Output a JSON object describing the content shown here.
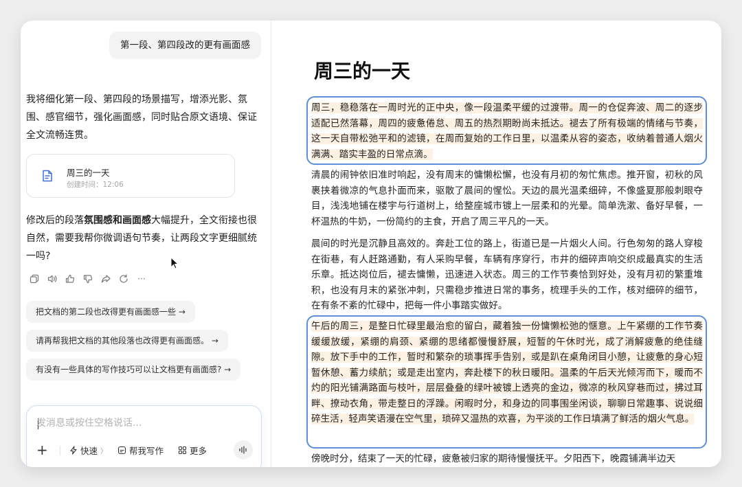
{
  "chat": {
    "user_message": "第一段、第四段改的更有画面感",
    "reply_intro": "我将细化第一段、第四段的场景描写，增添光影、氛围、感官细节，强化画面感，同时贴合原文语境、保证全文流畅连贯。",
    "doc_card": {
      "title": "周三的一天",
      "time": "创建时间：12:06"
    },
    "reply_followup_prefix": "修改后的段落",
    "reply_followup_bold": "氛围感和画面感",
    "reply_followup_suffix": "大幅提升，全文衔接也很自然，需要我帮你微调语句节奏，让两段文字更细腻统一吗?",
    "actions": [
      "copy-icon",
      "speaker-icon",
      "thumbs-up-icon",
      "thumbs-down-icon",
      "share-icon",
      "regenerate-icon",
      "more-icon"
    ],
    "more_label": "···",
    "suggestions": [
      "把文档的第二段也改得更有画面感一些 →",
      "请再帮我把文档的其他段落也改得更有画面感。 →",
      "有没有一些具体的写作技巧可以让文档更有画面感? →"
    ],
    "composer": {
      "placeholder": "发消息或按住空格说话...",
      "plus_label": "+",
      "quick_label": "快速",
      "quick_chevron": "〉",
      "write_label": "帮我写作",
      "more_label": "更多"
    }
  },
  "document": {
    "title": "周三的一天",
    "paragraphs": [
      {
        "text": "周三，稳稳落在一周时光的正中央，像一段温柔平缓的过渡带。周一的仓促奔波、周二的逐步适配已然落幕，周四的疲惫倦怠、周五的热烈期盼尚未抵达。褪去了所有极端的情绪与节奏，这一天自带松弛平和的滤镜，在周而复始的工作日里，以温柔从容的姿态，收纳着普通人烟火满满、踏实丰盈的日常点滴。",
        "highlighted": true
      },
      {
        "text": "清晨的闹钟依旧准时响起，没有周末的慵懒松懈，也没有月初的匆忙焦虑。推开窗，初秋的风裹挟着微凉的气息扑面而来，驱散了晨间的惺忪。天边的晨光温柔细碎，不像盛夏那般刺眼夺目，浅浅地铺在楼宇与行道树上，给整座城市镀上一层柔和的光晕。简单洗漱、备好早餐，一杯温热的牛奶，一份简约的主食，开启了周三平凡的一天。",
        "highlighted": false
      },
      {
        "text": "晨间的时光是沉静且高效的。奔赴工位的路上，街道已是一片烟火人间。行色匆匆的路人穿梭在街巷，有人赶路通勤，有人采购早餐，车辆有序穿行，市井的细碎声响交织成最真实的生活乐章。抵达岗位后，褪去慵懒，迅速进入状态。周三的工作节奏恰到好处，没有月初的繁重堆积，也没有月末的紧张冲刺，只需稳步推进日常的事务，梳理手头的工作，核对细碎的细节，在有条不紊的忙碌中，把每一件小事踏实做好。",
        "highlighted": false
      },
      {
        "text": "午后的周三，是整日忙碌里最治愈的留白，藏着独一份慵懒松弛的惬意。上午紧绷的工作节奏缓缓放缓，紧绷的肩颈、紧绷的思绪都慢慢舒展，短暂的午休时光，成了消解疲惫的绝佳缝隙。放下手中的工作，暂时和繁杂的琐事挥手告别，或是趴在桌角闭目小憩，让疲惫的身心短暂休憩、蓄力续航；或是走出室内，奔赴楼下的秋日暖阳。温柔的午后天光倾泻而下，暖而不灼的阳光铺满路面与枝叶，层层叠叠的绿叶被镀上透亮的金边，微凉的秋风穿巷而过，拂过耳畔、撩动衣角，带走整日的浮躁。闲暇时分，和身边的同事围坐闲谈，聊聊日常趣事、说说细碎生活，轻声笑语漫在空气里，琐碎又温热的欢喜，为平淡的工作日填满了鲜活的烟火气息。",
        "highlighted": true
      },
      {
        "text": "傍晚时分，结束了一天的忙碌，疲惫被归家的期待慢慢抚平。夕阳西下，晚霞铺满半边天",
        "highlighted": false
      }
    ]
  },
  "colors": {
    "highlight_bg": "#fdf1e3",
    "highlight_border": "#5b8edb",
    "composer_border": "#d0def6"
  }
}
